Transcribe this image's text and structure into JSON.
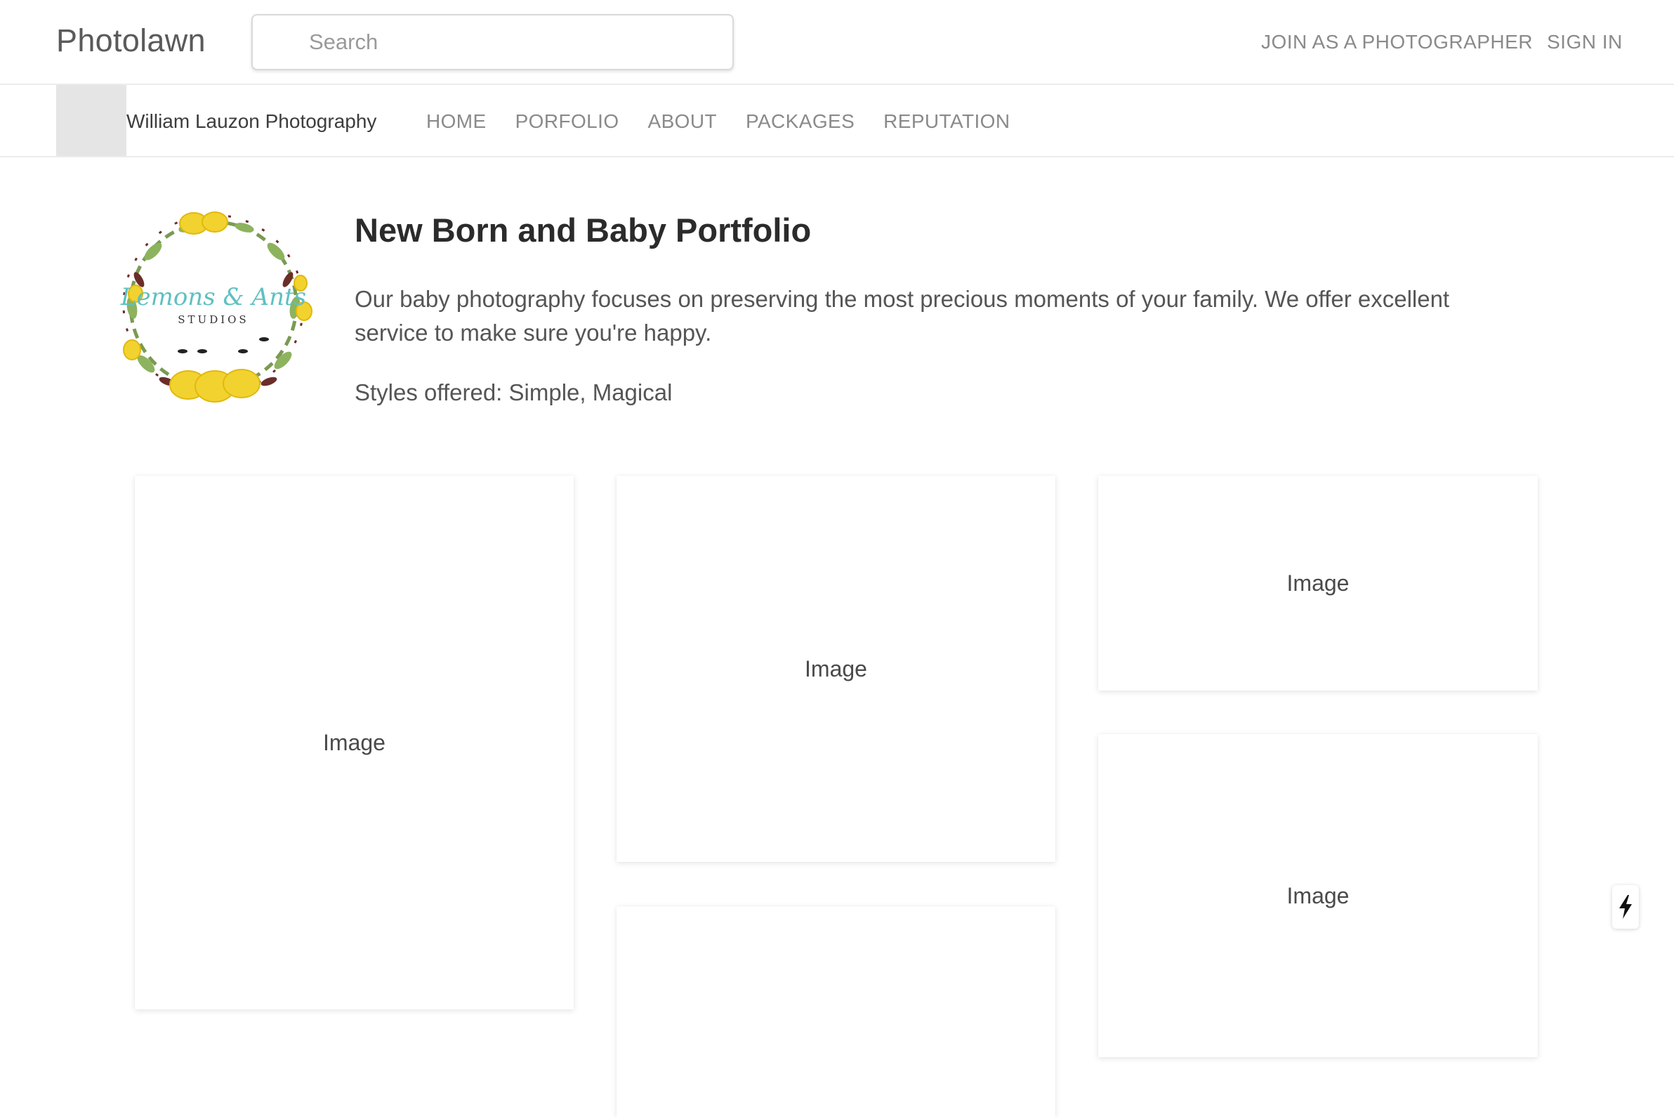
{
  "topbar": {
    "brand": "Photolawn",
    "search_placeholder": "Search",
    "join_link": "JOIN AS A PHOTOGRAPHER",
    "signin_link": "SIGN IN"
  },
  "subnav": {
    "studio_name": "William Lauzon Photography",
    "items": [
      {
        "label": "HOME"
      },
      {
        "label": "PORFOLIO"
      },
      {
        "label": "ABOUT"
      },
      {
        "label": "PACKAGES"
      },
      {
        "label": "REPUTATION"
      }
    ]
  },
  "logo": {
    "line1": "Lemons & Ants",
    "line2": "STUDIOS"
  },
  "portfolio": {
    "title": "New Born and Baby Portfolio",
    "description": "Our baby photography focuses on preserving the most precious moments of your family. We offer excellent service to make sure you're happy.",
    "styles": "Styles offered: Simple, Magical"
  },
  "gallery": {
    "cards": [
      {
        "label": "Image"
      },
      {
        "label": "Image"
      },
      {
        "label": ""
      },
      {
        "label": "Image"
      },
      {
        "label": "Image"
      }
    ]
  },
  "icons": {
    "floating_button": "bolt-icon",
    "logo": "lemon-wreath-logo"
  }
}
